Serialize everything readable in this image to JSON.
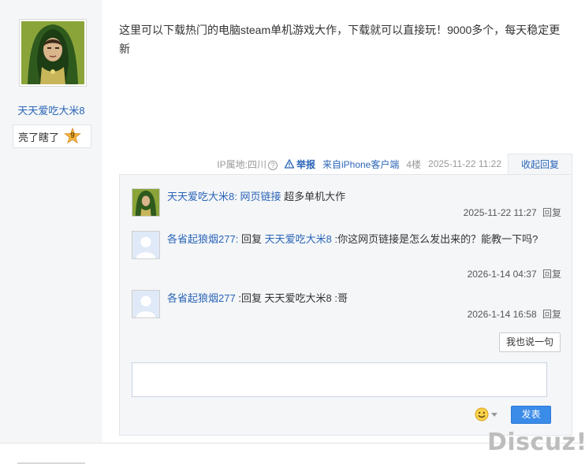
{
  "author": {
    "name": "天天爱吃大米8",
    "badge_label": "亮了瞎了",
    "badge_level": "9"
  },
  "post": {
    "content": "这里可以下载热门的电脑steam单机游戏大作，下载就可以直接玩！9000多个，每天稳定更新"
  },
  "meta": {
    "ip_location": "IP属地:四川",
    "help_glyph": "?",
    "report_label": "举报",
    "client": "来自iPhone客户端",
    "floor": "4楼",
    "time": "2025-11-22 11:22",
    "collapse_label": "收起回复"
  },
  "replies": [
    {
      "user": "天天爱吃大米8",
      "colon": ":",
      "link_text": "网页链接",
      "text": "超多单机大作",
      "time": "2025-11-22 11:27",
      "reply_label": "回复"
    },
    {
      "user": "各省起狼烟277",
      "colon": ":",
      "prefix": "回复",
      "target": "天天爱吃大米8",
      "text": ":你这网页链接是怎么发出来的？能教一下吗?",
      "time": "2026-1-14 04:37",
      "reply_label": "回复"
    },
    {
      "user": "各省起狼烟277",
      "text": ":回复 天天爱吃大米8 :哥",
      "time": "2026-1-14 16:58",
      "reply_label": "回复"
    }
  ],
  "actions": {
    "say_something": "我也说一句",
    "emoji_icon": "smiley-icon",
    "send": "发表"
  },
  "watermark": "Discuz!",
  "colors": {
    "link": "#2b65b7",
    "sidebar_bg": "#f4f6f8",
    "send_button": "#3b8be8"
  }
}
